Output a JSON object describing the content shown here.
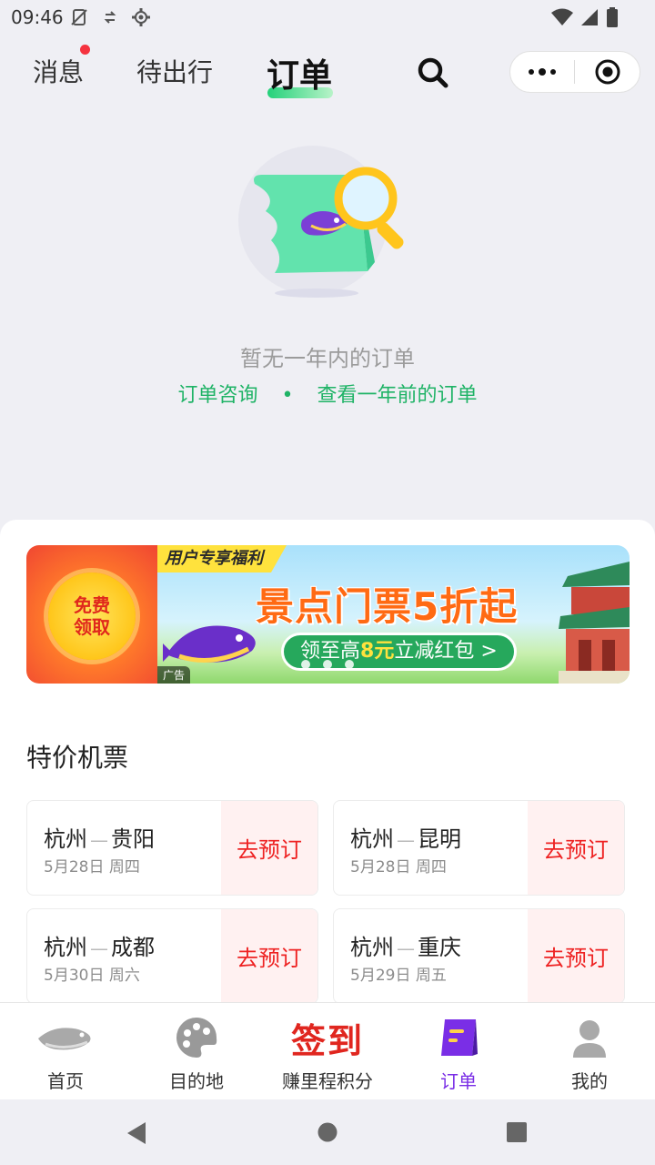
{
  "status_bar": {
    "time": "09:46"
  },
  "top_nav": {
    "tabs": [
      {
        "label": "消息",
        "has_badge": true
      },
      {
        "label": "待出行"
      },
      {
        "label": "订单",
        "active": true
      }
    ]
  },
  "empty_state": {
    "message": "暂无一年内的订单",
    "link_consult": "订单咨询",
    "separator": "•",
    "link_history": "查看一年前的订单"
  },
  "promo": {
    "free_coin_text": "免费领取",
    "banner_tag": "用户专享福利",
    "banner_title": "景点门票5折起",
    "pill_prefix": "领至高",
    "pill_amount": "8元",
    "pill_suffix": "立减红包 >",
    "ad_label": "广告"
  },
  "flights": {
    "section_title": "特价机票",
    "book_label": "去预订",
    "route_separator": "—",
    "items": [
      {
        "from": "杭州",
        "to": "贵阳",
        "date": "5月28日 周四"
      },
      {
        "from": "杭州",
        "to": "昆明",
        "date": "5月28日 周四"
      },
      {
        "from": "杭州",
        "to": "成都",
        "date": "5月30日 周六"
      },
      {
        "from": "杭州",
        "to": "重庆",
        "date": "5月29日 周五"
      }
    ]
  },
  "bottom_tabs": [
    {
      "label": "首页",
      "icon": "whale-icon"
    },
    {
      "label": "目的地",
      "icon": "palette-icon"
    },
    {
      "label": "赚里程积分",
      "icon_text": "签到"
    },
    {
      "label": "订单",
      "icon": "order-icon",
      "active": true
    },
    {
      "label": "我的",
      "icon": "user-icon"
    }
  ],
  "colors": {
    "accent_green": "#1fb366",
    "book_red": "#ee2222",
    "active_purple": "#7a2ee6",
    "badge_red": "#f5333f"
  }
}
